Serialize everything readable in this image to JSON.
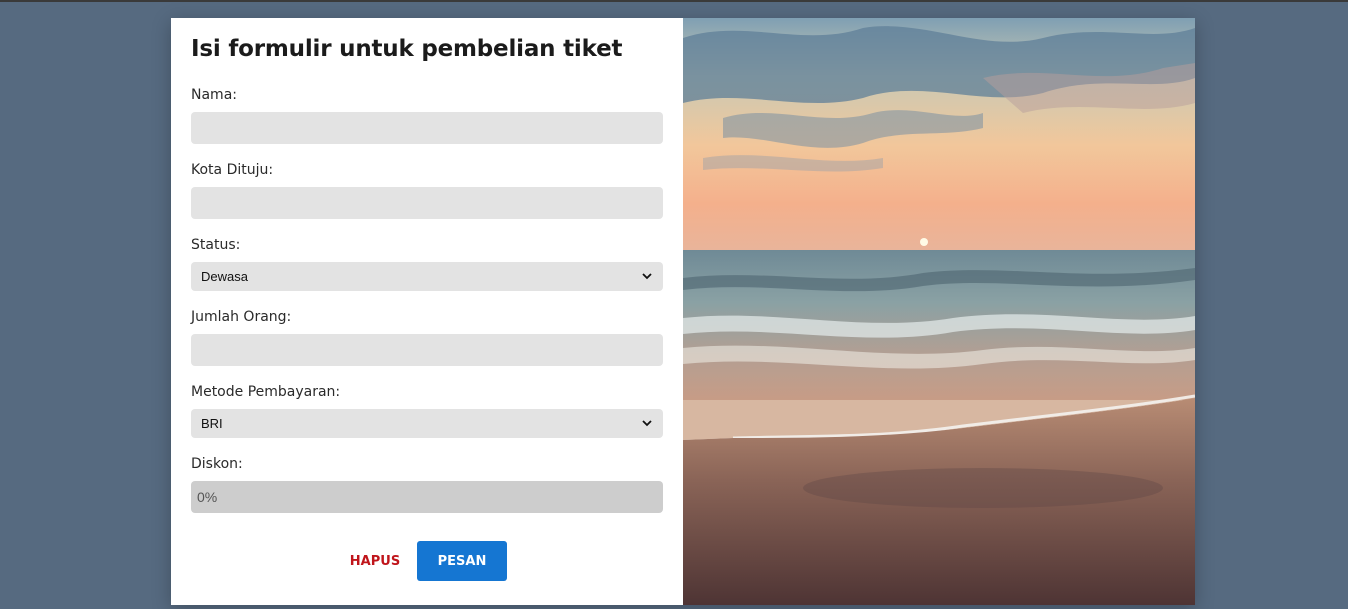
{
  "form": {
    "title": "Isi formulir untuk pembelian tiket",
    "nama_label": "Nama:",
    "nama_value": "",
    "kota_label": "Kota Dituju:",
    "kota_value": "",
    "status_label": "Status:",
    "status_value": "Dewasa",
    "jumlah_label": "Jumlah Orang:",
    "jumlah_value": "",
    "metode_label": "Metode Pembayaran:",
    "metode_value": "BRI",
    "diskon_label": "Diskon:",
    "diskon_value": "0%",
    "hapus_label": "HAPUS",
    "pesan_label": "PESAN"
  },
  "colors": {
    "page_bg": "#566a80",
    "accent": "#1576d2",
    "danger": "#c0151b",
    "field_bg": "#e3e3e3"
  },
  "icons": {
    "select_arrow": "chevron-down-icon"
  }
}
